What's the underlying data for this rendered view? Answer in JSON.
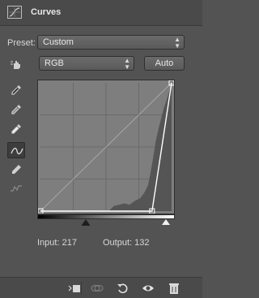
{
  "panel": {
    "title": "Curves",
    "icon": "curves-adjustment-icon"
  },
  "preset": {
    "label": "Preset:",
    "value": "Custom"
  },
  "channel": {
    "value": "RGB",
    "auto_label": "Auto"
  },
  "tools": [
    {
      "name": "on-image-adjust-tool",
      "icon": "hand-adjust-icon",
      "selected": false
    },
    {
      "name": "black-point-eyedropper",
      "icon": "eyedropper-black-icon",
      "selected": false
    },
    {
      "name": "gray-point-eyedropper",
      "icon": "eyedropper-gray-icon",
      "selected": false
    },
    {
      "name": "white-point-eyedropper",
      "icon": "eyedropper-white-icon",
      "selected": false
    },
    {
      "name": "edit-points-tool",
      "icon": "curve-points-icon",
      "selected": true
    },
    {
      "name": "draw-curve-tool",
      "icon": "pencil-icon",
      "selected": false
    },
    {
      "name": "smooth-curve-tool",
      "icon": "smooth-curve-icon",
      "selected": false
    }
  ],
  "curve": {
    "points": [
      [
        0,
        0
      ],
      [
        217,
        0
      ],
      [
        255,
        255
      ]
    ],
    "input_range": [
      0,
      255
    ],
    "output_range": [
      0,
      255
    ],
    "black_point_input": 217,
    "white_point_input": 255
  },
  "readout": {
    "input_label": "Input:",
    "input_value": "217",
    "output_label": "Output:",
    "output_value": "132"
  },
  "footer": {
    "icons": [
      "clip-to-layer-icon",
      "view-previous-state-icon",
      "reset-icon",
      "visibility-eye-icon",
      "trash-icon"
    ]
  },
  "colors": {
    "panel_bg": "#535353",
    "graph_bg": "#7e7e7e",
    "histogram": "#555555"
  }
}
